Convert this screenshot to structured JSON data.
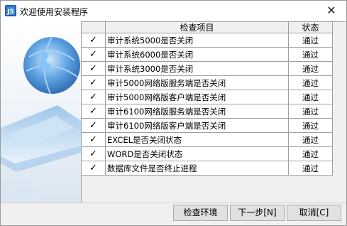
{
  "window": {
    "title": "欢迎使用安装程序",
    "close_glyph": "✕"
  },
  "table": {
    "headers": {
      "check": "",
      "item": "检查项目",
      "status": "状态"
    },
    "rows": [
      {
        "mark": "✓",
        "item": "审计系统5000是否关闭",
        "status": "通过"
      },
      {
        "mark": "✓",
        "item": "审计系统6000是否关闭",
        "status": "通过"
      },
      {
        "mark": "✓",
        "item": "审计系统3000是否关闭",
        "status": "通过"
      },
      {
        "mark": "✓",
        "item": "审计5000网络版服务端是否关闭",
        "status": "通过"
      },
      {
        "mark": "✓",
        "item": "审计5000网络版客户端是否关闭",
        "status": "通过"
      },
      {
        "mark": "✓",
        "item": "审计6100网络版服务端是否关闭",
        "status": "通过"
      },
      {
        "mark": "✓",
        "item": "审计6100网络版客户端是否关闭",
        "status": "通过"
      },
      {
        "mark": "✓",
        "item": "EXCEL是否关闭状态",
        "status": "通过"
      },
      {
        "mark": "✓",
        "item": "WORD是否关闭状态",
        "status": "通过"
      },
      {
        "mark": "✓",
        "item": "数据库文件是否终止进程",
        "status": "通过"
      }
    ]
  },
  "buttons": {
    "check_env": "检查环境",
    "next": "下一步[N]",
    "cancel": "取消[C]"
  },
  "icons": {
    "app": "installer-app-icon",
    "close": "close-icon",
    "check": "checkmark-icon"
  }
}
